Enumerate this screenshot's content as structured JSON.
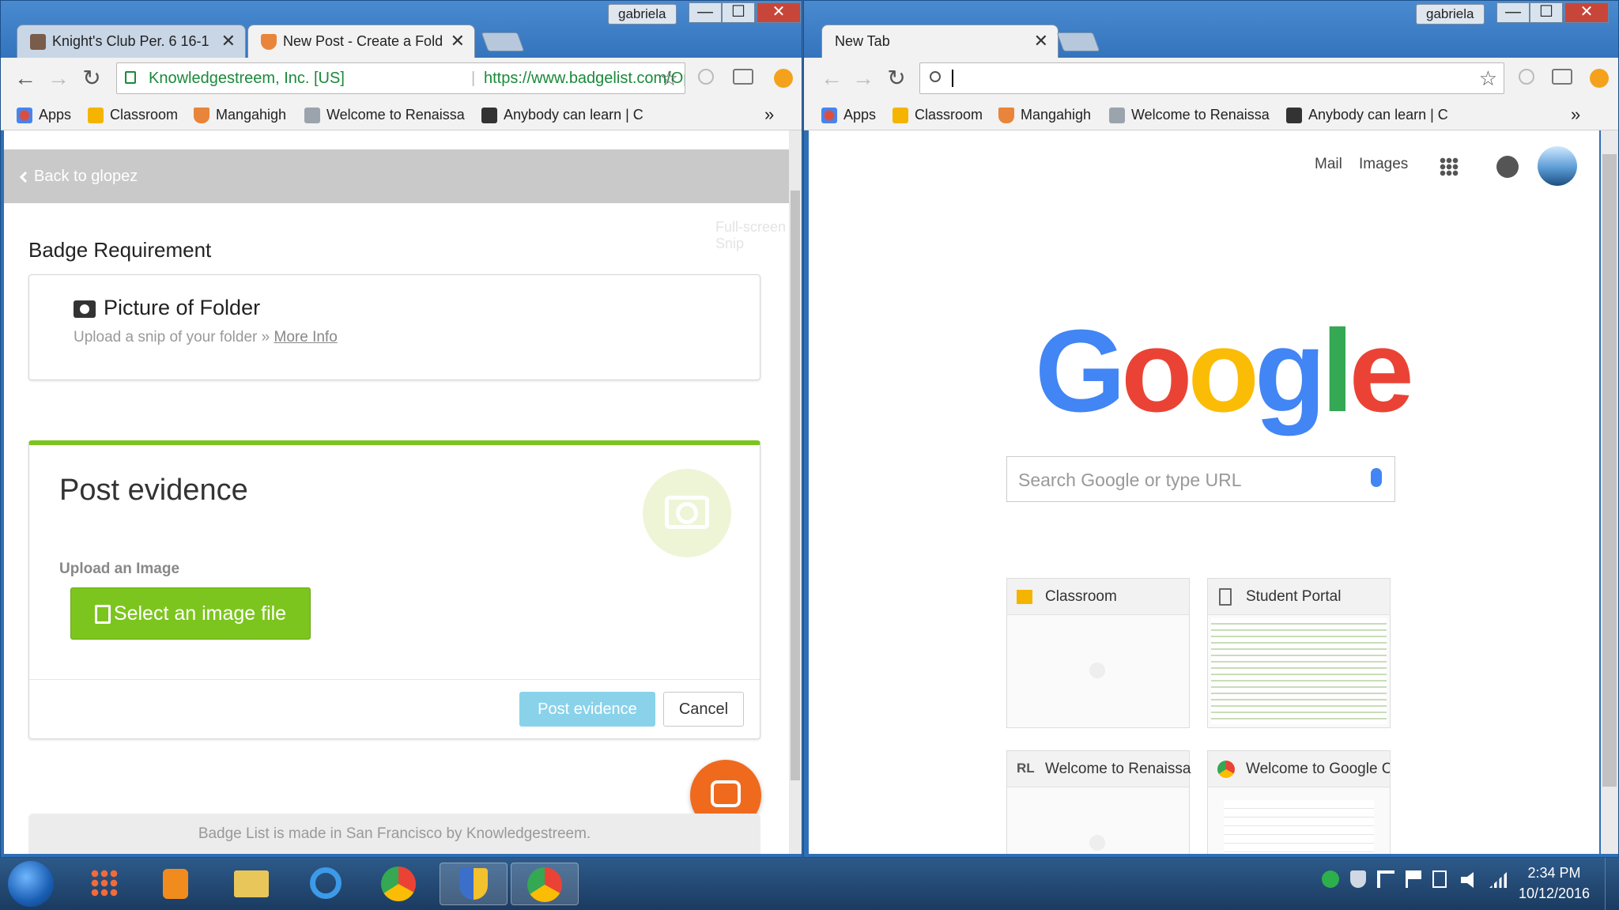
{
  "left_window": {
    "user": "gabriela",
    "controls": {
      "minimize": "—",
      "maximize": "☐",
      "close": "✕"
    },
    "tabs": [
      {
        "title": "Knight's Club Per. 6 16-1",
        "close": "✕"
      },
      {
        "title": "New Post - Create a Fold",
        "close": "✕"
      }
    ],
    "nav": {
      "back": "←",
      "forward": "→",
      "reload": "↻"
    },
    "address": {
      "identity": "Knowledgestreem, Inc. [US]",
      "separator": "|",
      "url": "https://www.badgelist.com/Operating-"
    },
    "star": "☆",
    "bookmarks": [
      "Apps",
      "Classroom",
      "Mangahigh",
      "Welcome to Renaissa",
      "Anybody can learn | C"
    ],
    "bookmarks_more": "»",
    "page": {
      "back_link": "Back to glopez",
      "overlay_hint": "Full-screen Snip",
      "section_title": "Badge Requirement",
      "requirement": {
        "title": "Picture of Folder",
        "description": "Upload a snip of your folder",
        "more_info_arrow": "»",
        "more_info": "More Info"
      },
      "post": {
        "title": "Post evidence",
        "upload_label": "Upload an Image",
        "select_button": "Select an image file",
        "submit_button": "Post evidence",
        "cancel_button": "Cancel"
      },
      "footer": "Badge List is made in San Francisco by Knowledgestreem.",
      "accent_color": "#7cc51e",
      "chat_color": "#f06a1d"
    }
  },
  "right_window": {
    "user": "gabriela",
    "controls": {
      "minimize": "—",
      "maximize": "☐",
      "close": "✕"
    },
    "tab": {
      "title": "New Tab",
      "close": "✕"
    },
    "nav": {
      "back": "←",
      "forward": "→",
      "reload": "↻"
    },
    "star": "☆",
    "bookmarks": [
      "Apps",
      "Classroom",
      "Mangahigh",
      "Welcome to Renaissa",
      "Anybody can learn | C"
    ],
    "bookmarks_more": "»",
    "page": {
      "links": {
        "mail": "Mail",
        "images": "Images"
      },
      "logo": [
        "G",
        "o",
        "o",
        "g",
        "l",
        "e"
      ],
      "search_placeholder": "Search Google or type URL",
      "tiles": [
        {
          "title": "Classroom"
        },
        {
          "title": "Student Portal"
        },
        {
          "title": "Welcome to Renaissa",
          "badge": "RL"
        },
        {
          "title": "Welcome to Google C"
        }
      ]
    }
  },
  "taskbar": {
    "clock_time": "2:34 PM",
    "clock_date": "10/12/2016"
  }
}
